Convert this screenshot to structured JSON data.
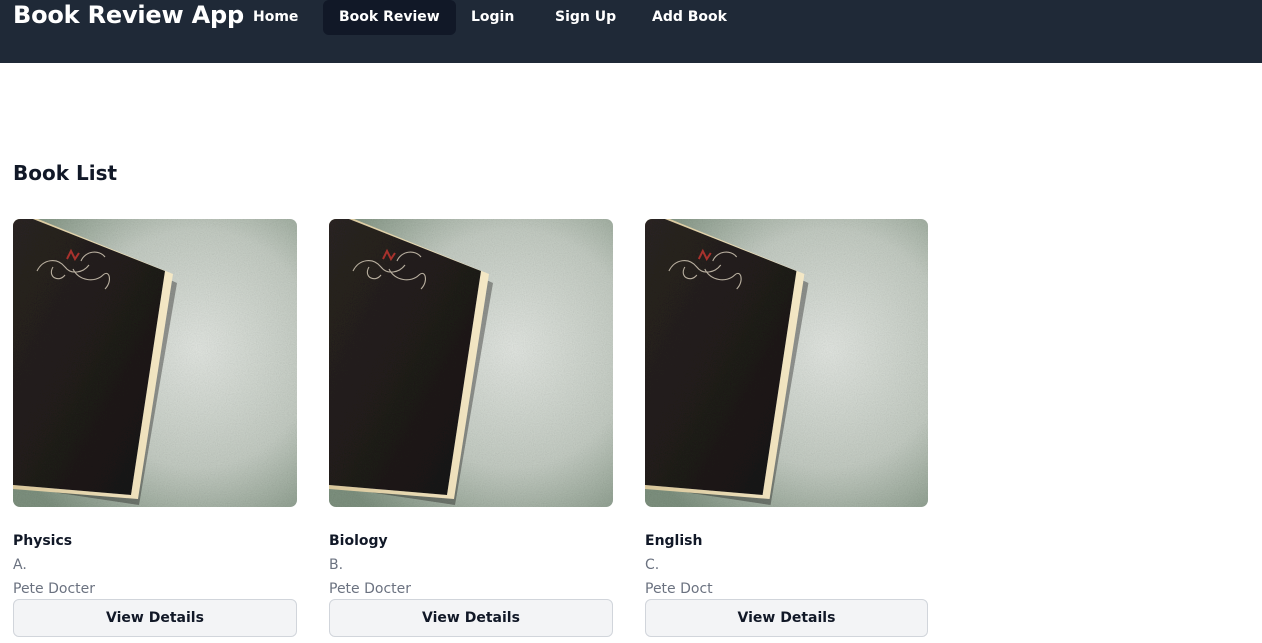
{
  "nav": {
    "brand": "Book Review App",
    "links": [
      {
        "label": "Home",
        "active": false
      },
      {
        "label": "Book Review",
        "active": true
      },
      {
        "label": "Login",
        "active": false
      },
      {
        "label": "Sign Up",
        "active": false
      },
      {
        "label": "Add Book",
        "active": false
      }
    ]
  },
  "main": {
    "title": "Book List",
    "books": [
      {
        "title": "Physics",
        "subtitle": "A.",
        "author": "Pete Docter",
        "button": "View Details"
      },
      {
        "title": "Biology",
        "subtitle": "B.",
        "author": "Pete Docter",
        "button": "View Details"
      },
      {
        "title": "English",
        "subtitle": "C.",
        "author": "Pete Doct",
        "button": "View Details"
      }
    ]
  },
  "colors": {
    "navbar_bg": "#1f2937",
    "active_link_bg": "#111827",
    "button_bg": "#f3f4f6",
    "muted_text": "#6b7280"
  }
}
